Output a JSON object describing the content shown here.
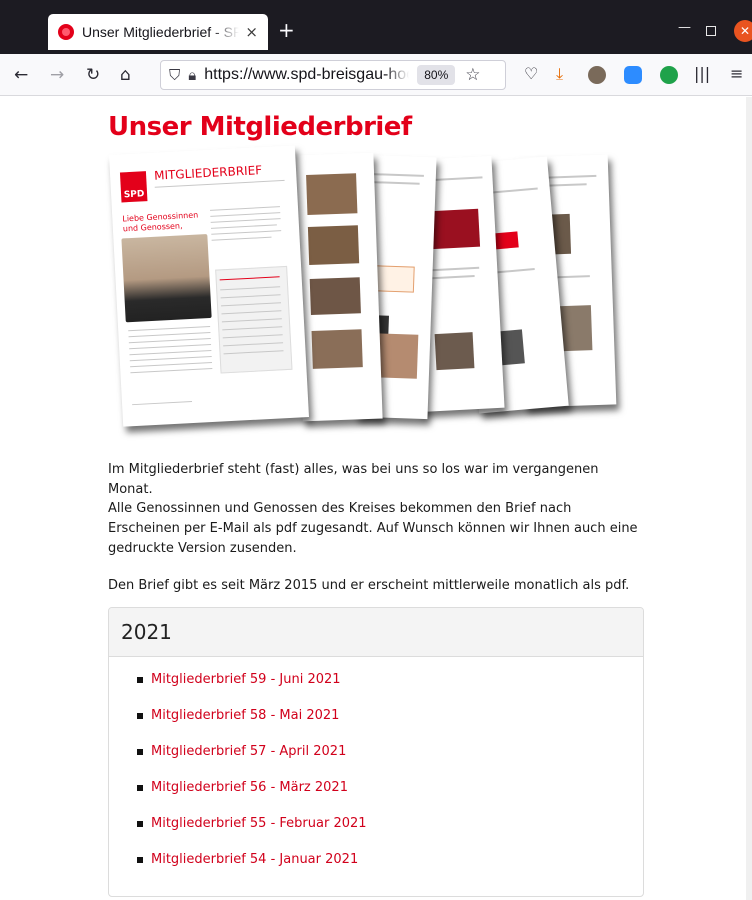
{
  "browser": {
    "tab_title": "Unser Mitgliederbrief - SP",
    "tab_close": "×",
    "newtab": "+",
    "url": "https://www.spd-breisgau-hoc",
    "zoom": "80%",
    "icons": [
      "back-icon",
      "forward-icon",
      "reload-icon",
      "home-icon",
      "shield-icon",
      "lock-icon",
      "star-icon",
      "pocket-icon",
      "download-icon",
      "avatar-icon",
      "zoom-ext-icon",
      "green-ext-icon",
      "library-icon",
      "menu-icon"
    ]
  },
  "page": {
    "title": "Unser Mitgliederbrief",
    "para1": "Im Mitgliederbrief steht (fast) alles, was bei uns so los war im vergangenen Monat.",
    "para2": "Alle Genossinnen und Genossen des Kreises bekommen den Brief nach Erscheinen per E-Mail als pdf zugesandt. Auf Wunsch können wir Ihnen auch eine gedruckte Version zusenden.",
    "para3": "Den Brief gibt es seit März 2015 und er erscheint mittlerweile monatlich als pdf.",
    "hero": {
      "cover_title": "MITGLIEDERBRIEF",
      "logo": "SPD",
      "greeting": "Liebe Genossinnen und Genossen,"
    },
    "year_section": {
      "year": "2021",
      "letters": [
        "Mitgliederbrief 59 - Juni 2021",
        "Mitgliederbrief 58 - Mai 2021",
        "Mitgliederbrief 57 - April 2021",
        "Mitgliederbrief 56 - März 2021",
        "Mitgliederbrief 55 - Februar 2021",
        "Mitgliederbrief 54 - Januar 2021"
      ]
    }
  },
  "colors": {
    "brand_red": "#e3001a",
    "link_red": "#d1001b",
    "chrome_dark": "#1c1b22"
  }
}
